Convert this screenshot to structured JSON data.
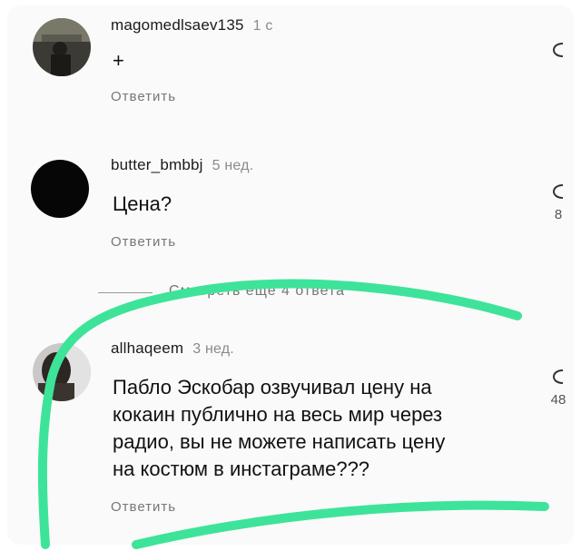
{
  "comments": [
    {
      "username": "magomedlsaev135",
      "time": "1 с",
      "text": "+",
      "reply_label": "Ответить",
      "like_count": ""
    },
    {
      "username": "butter_bmbbj",
      "time": "5 нед.",
      "text": "Цена?",
      "reply_label": "Ответить",
      "like_count": "8"
    },
    {
      "username": "allhaqeem",
      "time": "3 нед.",
      "text_lines": [
        "Пабло Эскобар озвучивал цену на",
        "кокаин публично на весь мир через",
        "радио, вы не можете написать цену",
        "на костюм в инстаграме???"
      ],
      "reply_label": "Ответить",
      "like_count": "48"
    }
  ],
  "view_replies_label": "Смотреть еще 4 ответа",
  "colors": {
    "highlight": "#3ee39a",
    "muted_text": "#777777",
    "background": "#fafafa"
  },
  "icons": [
    "heart-outline-icon"
  ]
}
